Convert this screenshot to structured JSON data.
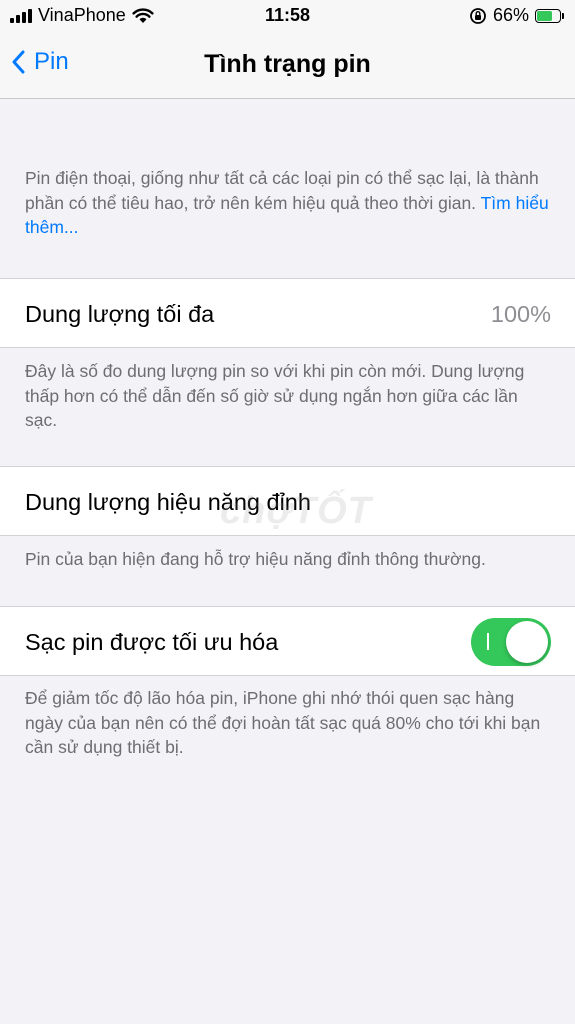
{
  "status_bar": {
    "carrier": "VinaPhone",
    "time": "11:58",
    "battery_percent": "66%",
    "battery_level": 0.66,
    "icons": [
      "signal-icon",
      "wifi-icon",
      "orientation-lock-icon",
      "battery-charging-icon"
    ]
  },
  "nav": {
    "back_label": "Pin",
    "title": "Tình trạng pin"
  },
  "intro": {
    "text": "Pin điện thoại, giống như tất cả các loại pin có thể sạc lại, là thành phần có thể tiêu hao, trở nên kém hiệu quả theo thời gian.",
    "link": "Tìm hiểu thêm..."
  },
  "max_capacity": {
    "label": "Dung lượng tối đa",
    "value": "100%",
    "footnote": "Đây là số đo dung lượng pin so với khi pin còn mới. Dung lượng thấp hơn có thể dẫn đến số giờ sử dụng ngắn hơn giữa các lần sạc."
  },
  "peak_performance": {
    "label": "Dung lượng hiệu năng đỉnh",
    "footnote": "Pin của bạn hiện đang hỗ trợ hiệu năng đỉnh thông thường."
  },
  "optimized_charging": {
    "label": "Sạc pin được tối ưu hóa",
    "enabled": true,
    "footnote": "Để giảm tốc độ lão hóa pin, iPhone ghi nhớ thói quen sạc hàng ngày của bạn nên có thể đợi hoàn tất sạc quá 80% cho tới khi bạn cần sử dụng thiết bị."
  },
  "watermark": "chợTỐT",
  "colors": {
    "accent": "#007aff",
    "toggle_on": "#34c759",
    "background": "#f2f2f7",
    "secondary_text": "#6d6d72"
  }
}
